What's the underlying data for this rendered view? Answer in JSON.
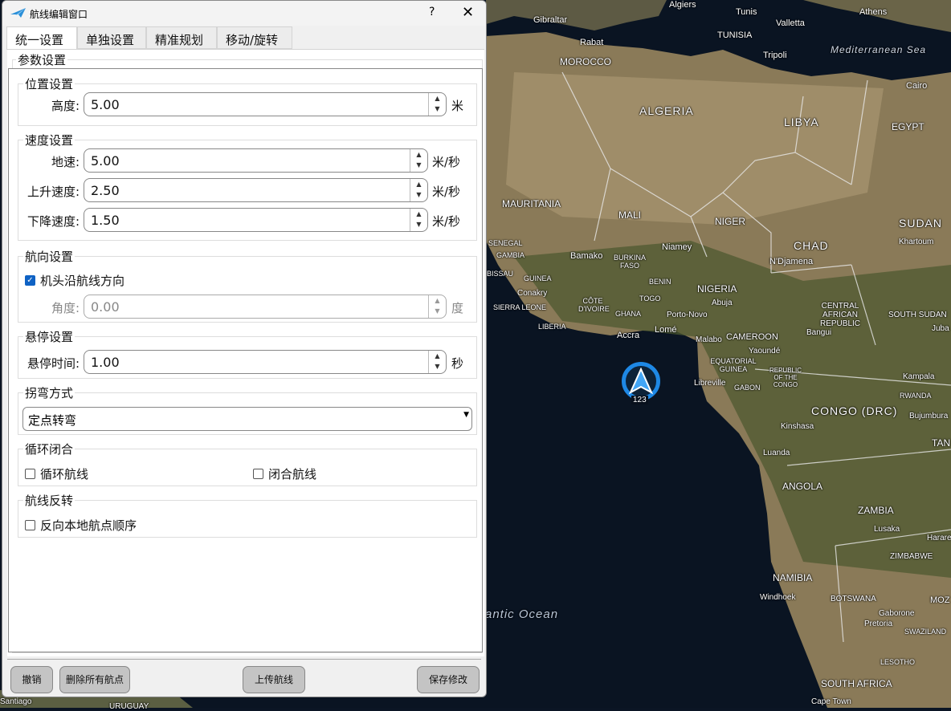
{
  "window": {
    "title": "航线编辑窗口",
    "help": "?",
    "close": "✕"
  },
  "tabs": [
    {
      "label": "统一设置"
    },
    {
      "label": "单独设置"
    },
    {
      "label": "精准规划"
    },
    {
      "label": "移动/旋转"
    }
  ],
  "params": {
    "title": "参数设置",
    "position": {
      "title": "位置设置",
      "altitude_label": "高度:",
      "altitude": "5.00",
      "altitude_unit": "米"
    },
    "speed": {
      "title": "速度设置",
      "ground_label": "地速:",
      "ground": "5.00",
      "ascend_label": "上升速度:",
      "ascend": "2.50",
      "descend_label": "下降速度:",
      "descend": "1.50",
      "unit": "米/秒"
    },
    "heading": {
      "title": "航向设置",
      "follow_label": "机头沿航线方向",
      "follow_checked": true,
      "angle_label": "角度:",
      "angle": "0.00",
      "angle_unit": "度"
    },
    "hover": {
      "title": "悬停设置",
      "time_label": "悬停时间:",
      "time": "1.00",
      "unit": "秒"
    },
    "turn": {
      "title": "拐弯方式",
      "selected": "定点转弯"
    },
    "loop": {
      "title": "循环闭合",
      "loop_label": "循环航线",
      "close_label": "闭合航线"
    },
    "reverse": {
      "title": "航线反转",
      "reverse_label": "反向本地航点顺序"
    }
  },
  "buttons": {
    "cancel": "撤销",
    "delete_all": "删除所有航点",
    "upload": "上传航线",
    "save": "保存修改"
  },
  "marker": {
    "label": "123",
    "color": "#1e88e5"
  },
  "map_labels": {
    "algiers": "Algiers",
    "tunis": "Tunis",
    "valletta": "Valletta",
    "athens": "Athens",
    "gibraltar": "Gibraltar",
    "tunisia": "TUNISIA",
    "rabat": "Rabat",
    "med": "Mediterranean Sea",
    "morocco": "MOROCCO",
    "tripoli": "Tripoli",
    "cairo": "Cairo",
    "algeria": "ALGERIA",
    "libya": "LIBYA",
    "egypt": "EGYPT",
    "mauritania": "MAURITANIA",
    "mali": "MALI",
    "niger": "NIGER",
    "sudan": "SUDAN",
    "khartoum": "Khartoum",
    "chad": "CHAD",
    "niamey": "Niamey",
    "senegal": "SENEGAL",
    "gambia": "GAMBIA",
    "bamako": "Bamako",
    "burkina": "BURKINA FASO",
    "ndjamena": "N'Djamena",
    "bissau": "BISSAU",
    "guinea": "GUINEA",
    "benin": "BENIN",
    "nigeria": "NIGERIA",
    "conakry": "Conakry",
    "togo": "TOGO",
    "abuja": "Abuja",
    "sierra": "SIERRA LEONE",
    "cote": "CÔTE D'IVOIRE",
    "portonovo": "Porto-Novo",
    "car": "CENTRAL AFRICAN REPUBLIC",
    "southsudan": "SOUTH SUDAN",
    "ghana": "GHANA",
    "liberia": "LIBERIA",
    "accra": "Accra",
    "lome": "Lomé",
    "malabo": "Malabo",
    "cameroon": "CAMEROON",
    "bangui": "Bangui",
    "juba": "Juba",
    "yaounde": "Yaoundé",
    "eqguinea": "EQUATORIAL GUINEA",
    "roc": "REPUBLIC OF THE CONGO",
    "kampala": "Kampala",
    "libreville": "Libreville",
    "gabon": "GABON",
    "rwanda": "RWANDA",
    "drc": "CONGO (DRC)",
    "bujumbura": "Bujumbura",
    "kinshasa": "Kinshasa",
    "tan": "TAN",
    "luanda": "Luanda",
    "angola": "ANGOLA",
    "zambia": "ZAMBIA",
    "lusaka": "Lusaka",
    "harare": "Harare",
    "zimbabwe": "ZIMBABWE",
    "namibia": "NAMIBIA",
    "windhoek": "Windhoek",
    "botswana": "BOTSWANA",
    "moz": "MOZ",
    "atlantic": "antic Ocean",
    "gaborone": "Gaborone",
    "pretoria": "Pretoria",
    "swaziland": "SWAZILAND",
    "lesotho": "LESOTHO",
    "southafrica": "SOUTH AFRICA",
    "capetown": "Cape Town",
    "santiago": "Santiago",
    "uruguay": "URUGUAY"
  }
}
